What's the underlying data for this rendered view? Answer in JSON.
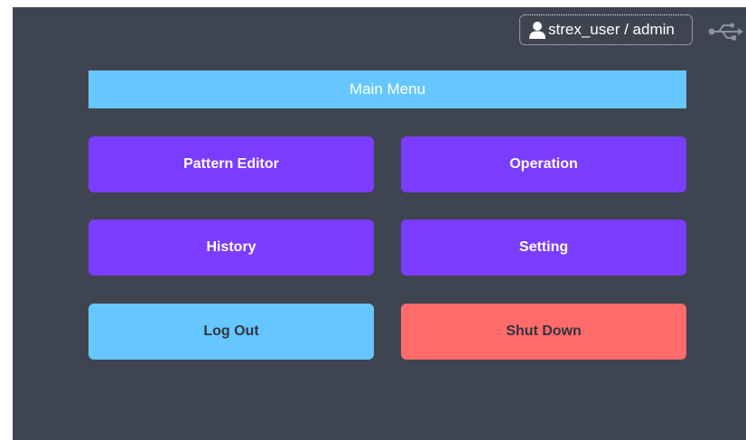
{
  "header": {
    "user_label": "strex_user / admin",
    "user_icon": "user-icon",
    "usb_icon": "usb-icon"
  },
  "menu": {
    "title": "Main Menu",
    "buttons": {
      "pattern_editor": "Pattern Editor",
      "operation": "Operation",
      "history": "History",
      "setting": "Setting",
      "log_out": "Log Out",
      "shut_down": "Shut Down"
    }
  },
  "colors": {
    "background": "#3f4451",
    "accent_blue": "#66c6ff",
    "primary_purple": "#7a3cff",
    "danger_red": "#ff6b6b"
  }
}
